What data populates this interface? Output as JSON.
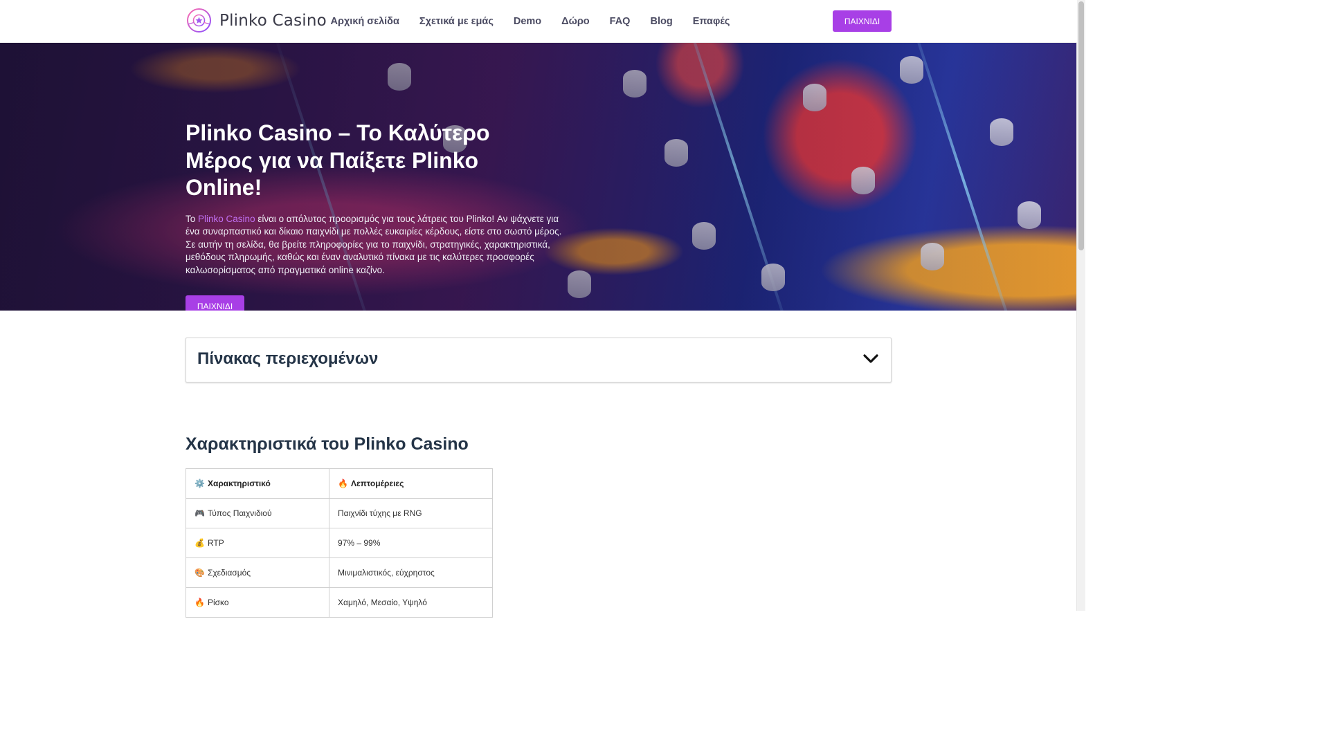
{
  "header": {
    "logo_text": "Plinko Casino",
    "nav": [
      "Αρχική σελίδα",
      "Σχετικά με εμάς",
      "Demo",
      "Δώρο",
      "FAQ",
      "Blog",
      "Επαφές"
    ],
    "cta_label": "ΠΑΙΧΝΙΔΙ"
  },
  "hero": {
    "title": "Plinko Casino – Το Καλύτερο Μέρος για να Παίξετε Plinko Online!",
    "text_prefix": "Το ",
    "text_link": "Plinko Casino",
    "text_rest": " είναι ο απόλυτος προορισμός για τους λάτρεις του Plinko! Αν ψάχνετε για ένα συναρπαστικό και δίκαιο παιχνίδι με πολλές ευκαιρίες κέρδους, είστε στο σωστό μέρος. Σε αυτήν τη σελίδα, θα βρείτε πληροφορίες για το παιχνίδι, στρατηγικές, χαρακτηριστικά, μεθόδους πληρωμής, καθώς και έναν αναλυτικό πίνακα με τις καλύτερες προσφορές καλωσορίσματος από πραγματικά online καζίνο.",
    "cta_label": "ΠΑΙΧΝΙΔΙ"
  },
  "toc": {
    "title": "Πίνακας περιεχομένων"
  },
  "features": {
    "title": "Χαρακτηριστικά του Plinko Casino",
    "header": [
      {
        "emoji": "⚙️",
        "label": "Χαρακτηριστικό"
      },
      {
        "emoji": "🔥",
        "label": "Λεπτομέρειες"
      }
    ],
    "rows": [
      {
        "emoji": "🎮",
        "feature": "Τύπος Παιχνιδιού",
        "detail": "Παιχνίδι τύχης με RNG"
      },
      {
        "emoji": "💰",
        "feature": "RTP",
        "detail": "97% – 99%"
      },
      {
        "emoji": "🎨",
        "feature": "Σχεδιασμός",
        "detail": "Μινιμαλιστικός, εύχρηστος"
      },
      {
        "emoji": "🔥",
        "feature": "Ρίσκο",
        "detail": "Χαμηλό, Μεσαίο, Υψηλό"
      }
    ]
  },
  "colors": {
    "accent": "#a83fe6",
    "heading": "#243447",
    "link": "#c070f2"
  }
}
